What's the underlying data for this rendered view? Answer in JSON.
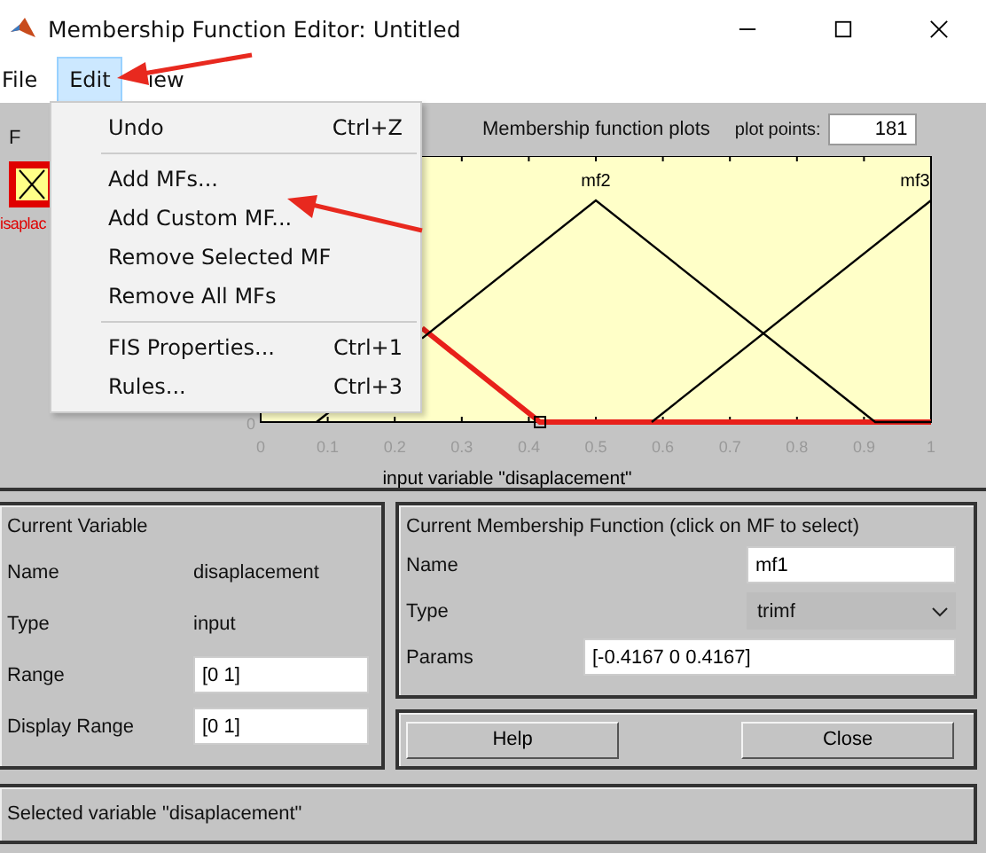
{
  "window": {
    "title": "Membership Function Editor: Untitled"
  },
  "menu_bar": [
    {
      "label": "File",
      "selected": false
    },
    {
      "label": "Edit",
      "selected": true
    },
    {
      "label": "iew",
      "selected": false
    }
  ],
  "edit_menu": {
    "groups": [
      [
        {
          "label": "Undo",
          "shortcut": "Ctrl+Z"
        }
      ],
      [
        {
          "label": "Add MFs..."
        },
        {
          "label": "Add Custom MF..."
        },
        {
          "label": "Remove Selected MF"
        },
        {
          "label": "Remove All MFs"
        }
      ],
      [
        {
          "label": "FIS Properties...",
          "shortcut": "Ctrl+1"
        },
        {
          "label": "Rules...",
          "shortcut": "Ctrl+3"
        }
      ]
    ]
  },
  "fis_variables": {
    "title": "F",
    "variable": {
      "label": "isaplac",
      "selected": true
    }
  },
  "plot": {
    "title": "Membership function plots",
    "plot_points_label": "plot points:",
    "plot_points": "181",
    "xlabel": "input variable \"disaplacement\"",
    "x_tick_labels": [
      "0",
      "0.1",
      "0.2",
      "0.3",
      "0.4",
      "0.5",
      "0.6",
      "0.7",
      "0.8",
      "0.9",
      "1"
    ],
    "y_tick_labels": [
      "0"
    ],
    "curve_labels": [
      "mf2",
      "mf3"
    ]
  },
  "current_variable": {
    "title": "Current Variable",
    "fields": [
      {
        "label": "Name",
        "value": "disaplacement",
        "kind": "text"
      },
      {
        "label": "Type",
        "value": "input",
        "kind": "text"
      },
      {
        "label": "Range",
        "value": "[0 1]",
        "kind": "input"
      },
      {
        "label": "Display Range",
        "value": "[0 1]",
        "kind": "input"
      }
    ]
  },
  "current_mf": {
    "title": "Current Membership Function (click on MF to select)",
    "fields": [
      {
        "label": "Name",
        "value": "mf1",
        "kind": "input"
      },
      {
        "label": "Type",
        "value": "trimf",
        "kind": "dropdown"
      },
      {
        "label": "Params",
        "value": "[-0.4167 0 0.4167]",
        "kind": "wide_input"
      }
    ]
  },
  "buttons": [
    "Help",
    "Close"
  ],
  "status": "Selected variable \"disaplacement\""
}
